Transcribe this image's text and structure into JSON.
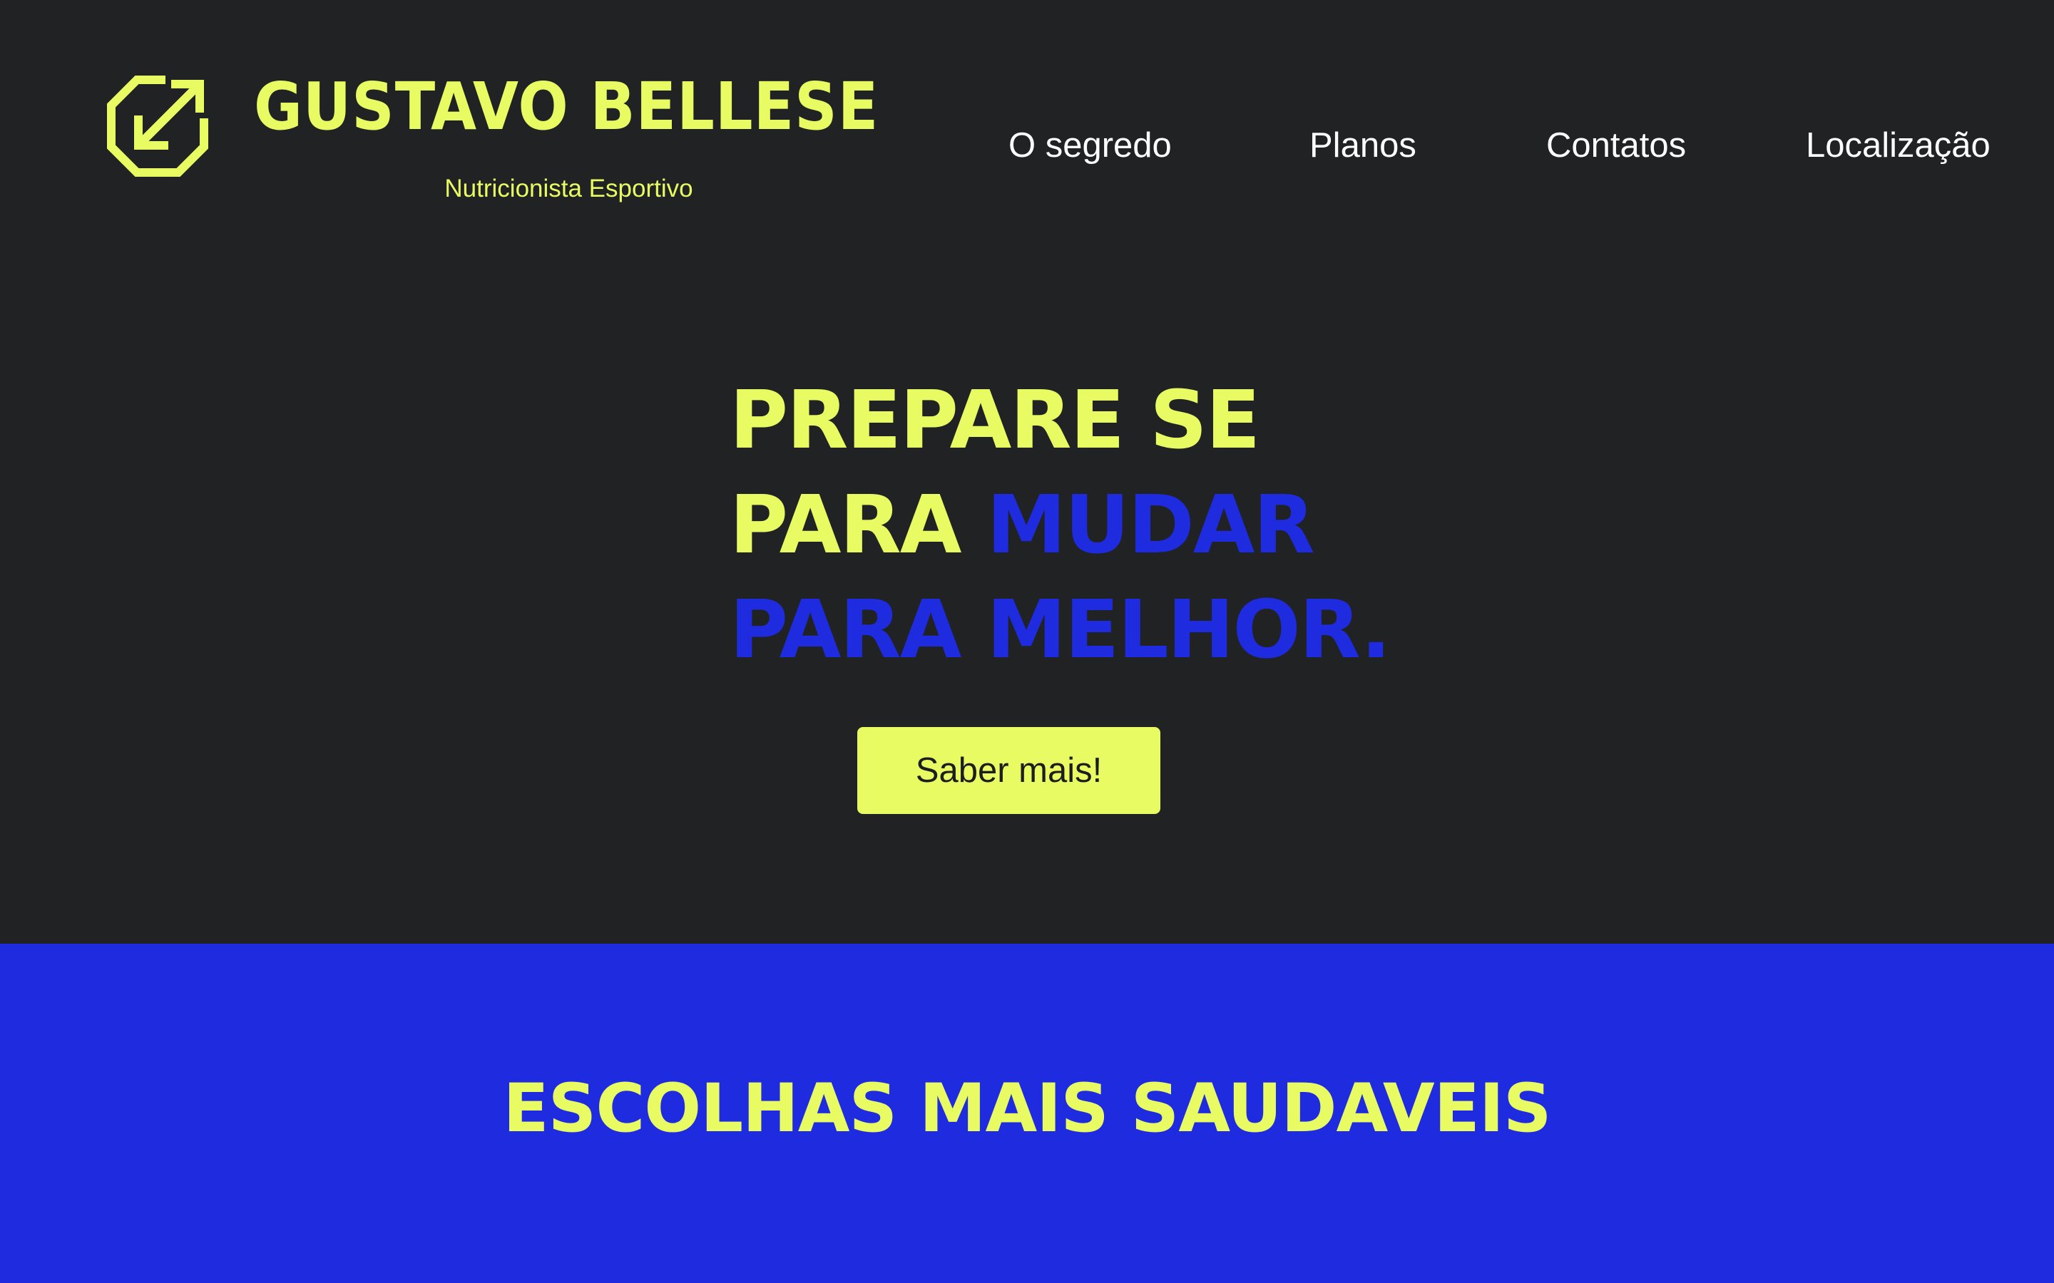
{
  "brand": {
    "name": "GUSTAVO BELLESE",
    "subtitle": "Nutricionista Esportivo",
    "logo_icon": "octagon-arrow-logo-icon"
  },
  "nav": {
    "items": [
      {
        "label": "O segredo"
      },
      {
        "label": "Planos"
      },
      {
        "label": "Contatos"
      },
      {
        "label": "Localização"
      }
    ]
  },
  "hero": {
    "line1": "PREPARE SE",
    "line2_part1": "PARA",
    "line2_part2": "MUDAR",
    "line3": "PARA MELHOR.",
    "cta_label": "Saber mais!"
  },
  "section": {
    "title": "ESCOLHAS MAIS SAUDAVEIS"
  },
  "colors": {
    "background_dark": "#212224",
    "accent_yellow": "#e9fb62",
    "accent_blue": "#1f2bdf",
    "nav_text": "#ffffff"
  }
}
